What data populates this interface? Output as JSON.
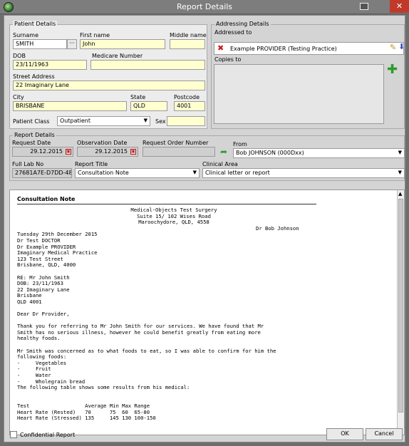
{
  "window": {
    "title": "Report Details"
  },
  "patient": {
    "group_title": "Patient Details",
    "surname_label": "Surname",
    "surname": "SMITH",
    "firstname_label": "First name",
    "firstname": "John",
    "middlename_label": "Middle name",
    "middlename": "",
    "dob_label": "DOB",
    "dob": "23/11/1963",
    "medicare_label": "Medicare Number",
    "medicare": "",
    "street_label": "Street Address",
    "street": "22 Imaginary Lane",
    "city_label": "City",
    "city": "BRISBANE",
    "state_label": "State",
    "state": "QLD",
    "postcode_label": "Postcode",
    "postcode": "4001",
    "class_label": "Patient Class",
    "class_value": "Outpatient",
    "sex_label": "Sex",
    "sex": ""
  },
  "addressing": {
    "group_title": "Addressing Details",
    "addressed_label": "Addressed to",
    "addressed_value": "Example PROVIDER (Testing Practice)",
    "copies_label": "Copies to"
  },
  "report": {
    "group_title": "Report Details",
    "request_date_label": "Request Date",
    "request_date": "29.12.2015",
    "obs_date_label": "Observation Date",
    "obs_date": "29.12.2015",
    "order_label": "Request Order Number",
    "order": "",
    "from_label": "From",
    "from_value": "Bob JOHNSON (000Dxx)",
    "lab_label": "Full Lab No",
    "lab_value": "27681A7E-D7DD-481F-",
    "title_label": "Report Title",
    "title_value": "Consultation Note",
    "clinical_label": "Clinical Area",
    "clinical_value": "Clinical letter or report"
  },
  "note": {
    "heading": "Consultation Note",
    "header_lines": [
      "Medical-Objects Test Surgery",
      "Suite 15/ 102 Wises Road",
      "Maroochydore, QLD, 4558"
    ],
    "doctor": "Dr Bob Johnson",
    "body": "Tuesday 29th December 2015\nDr Test DOCTOR\nDr Example PROVIDER\nImaginary Medical Practice\n123 Test Street\nBrisbane, QLD, 4000\n\nRE: Mr John Smith\nDOB: 23/11/1963\n22 Imaginary Lane\nBrisbane\nQLD 4001\n\nDear Dr Provider,\n\nThank you for referring to Mr John Smith for our services. We have found that Mr\nSmith has no serious illness, however he could benefit greatly from eating more\nhealthy foods.\n\nMr Smith was concerned as to what foods to eat, so I was able to confirm for him the\nfollowing foods:\n-     Vegetables\n-     Fruit\n-     Water\n-     Wholegrain bread\nThe following table shows some results from his medical:\n\n\nTest                  Average Min Max Range\nHeart Rate (Rested)   70      75  60  65-80\nHeart Rate (Stressed) 135     145 130 100-150"
  },
  "footer": {
    "confidential_label": "Confidential Report",
    "ok_label": "OK",
    "cancel_label": "Cancel"
  }
}
